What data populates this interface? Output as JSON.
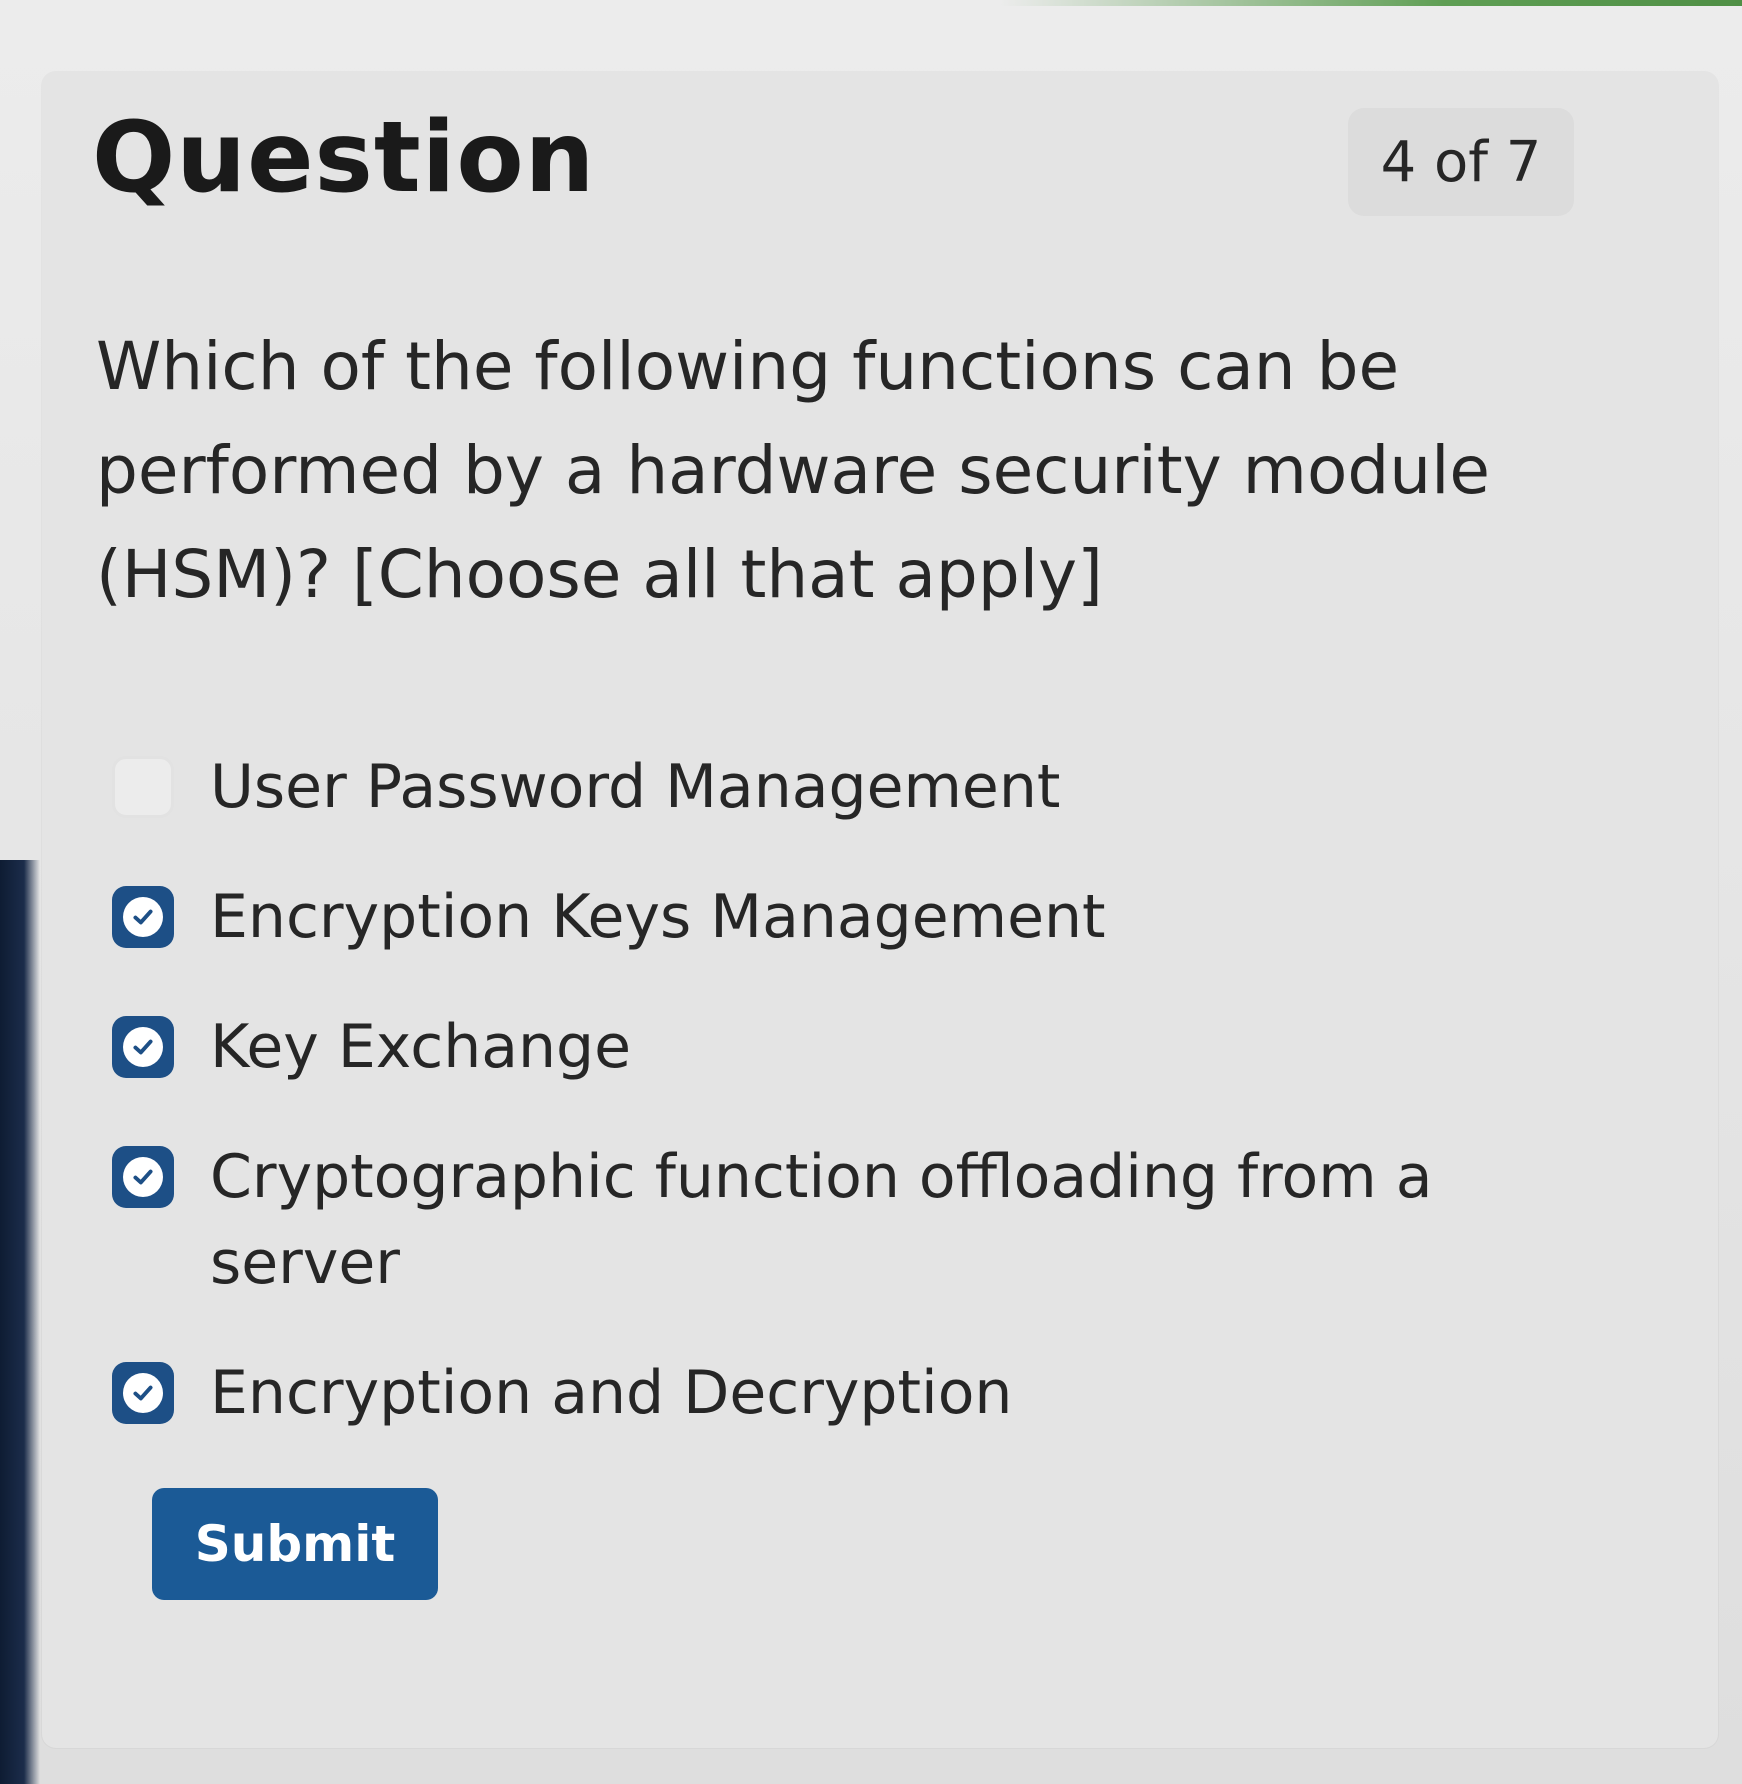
{
  "header": {
    "title": "Question",
    "counter": "4 of 7"
  },
  "question": {
    "text": "Which of the following functions can be performed by a hardware security module (HSM)? [Choose all that apply]"
  },
  "options": [
    {
      "label": "User Password Management",
      "checked": false
    },
    {
      "label": "Encryption Keys Management",
      "checked": true
    },
    {
      "label": "Key Exchange",
      "checked": true
    },
    {
      "label": "Cryptographic function offloading from a server",
      "checked": true
    },
    {
      "label": "Encryption and Decryption",
      "checked": true
    }
  ],
  "submit": {
    "label": "Submit"
  },
  "colors": {
    "checkbox_checked": "#1d4f86",
    "submit_button": "#1b5a96",
    "top_accent": "#5f9e54"
  },
  "icons": {
    "checked": "check-icon"
  }
}
